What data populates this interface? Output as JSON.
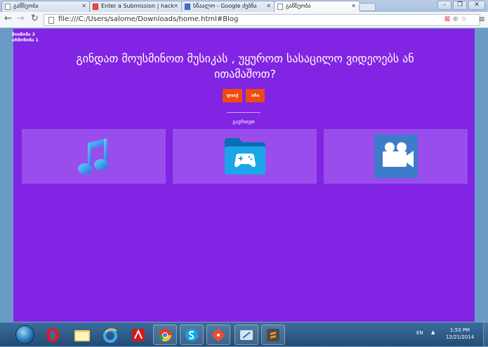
{
  "browser": {
    "tabs": [
      {
        "label": "გაწნუობა"
      },
      {
        "label": "Enter a Submission | hack"
      },
      {
        "label": "სწაალო - Google ძებნა"
      },
      {
        "label": "გაწნუობა"
      }
    ],
    "url": "file:///C:/Users/salome/Downloads/home.html#Blog"
  },
  "page": {
    "counters": [
      "მოიწონა 3",
      "არმოწონა 1"
    ],
    "headline": "გინდათ მოუსმინოთ მუსიკას , უყუროთ სასაცილო ვიდეოებს ან ითამაშოთ?",
    "like_label": "ლაიქ",
    "dislike_label": "არა",
    "subtitle": "გაერთეთ",
    "cards": [
      {
        "icon": "music-note-icon"
      },
      {
        "icon": "game-folder-icon"
      },
      {
        "icon": "video-camera-icon"
      }
    ],
    "colors": {
      "background": "#8224e3",
      "card": "#9a4ded",
      "button": "#f04b10"
    }
  },
  "taskbar": {
    "language": "EN",
    "time": "1:53 PM",
    "date": "12/21/2014"
  }
}
